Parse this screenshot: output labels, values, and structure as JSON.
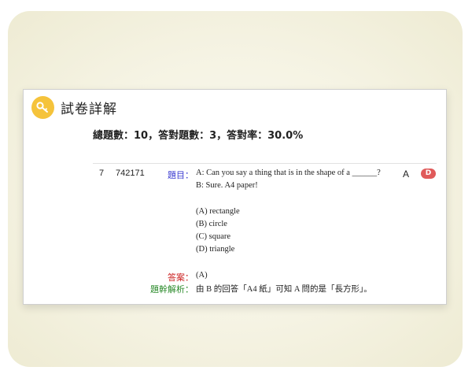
{
  "header": {
    "title": "試卷詳解",
    "icon": "key-icon",
    "icon_color": "#f5c33b"
  },
  "summary": "總題數：10，答對題數：3，答對率：30.0%",
  "question": {
    "number": "7",
    "id": "742171",
    "question_label": "題目：",
    "stem_line1": "A: Can you say a thing that is in the shape of a ______?",
    "stem_line2": "B: Sure. A4 paper!",
    "options": [
      "(A) rectangle",
      "(B) circle",
      "(C) square",
      "(D) triangle"
    ],
    "correct_answer_col": "A",
    "user_answer_badge": "D",
    "answer_label": "答案：",
    "answer_value": "(A)",
    "explanation_label": "題幹解析：",
    "explanation": "由 B 的回答「A4 紙」可知 A 問的是「長方形」。"
  },
  "colors": {
    "badge_wrong": "#e05a5a",
    "label_question": "#3a3ad0",
    "label_answer": "#cc2222",
    "label_explanation": "#2a8a2a"
  }
}
